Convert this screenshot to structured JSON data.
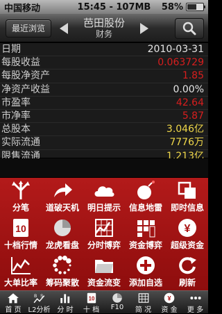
{
  "status_bar": {
    "carrier": "中国移动",
    "time_memory": "15:45 - 107MB",
    "battery": "58%",
    "battery_level": 0.58
  },
  "header": {
    "recent_label": "最近浏览",
    "stock_name": "芭田股份",
    "subtitle": "财务"
  },
  "rows": [
    {
      "label": "日期",
      "value": "2010-03-31",
      "color": "#e6e6e6"
    },
    {
      "label": "每股收益",
      "value": "0.063729",
      "color": "#d81e1e"
    },
    {
      "label": "每股净资产",
      "value": "1.85",
      "color": "#d81e1e"
    },
    {
      "label": "净资产收益",
      "value": "0.00%",
      "color": "#e6e6e6"
    },
    {
      "label": "市盈率",
      "value": "42.64",
      "color": "#d81e1e"
    },
    {
      "label": "市净率",
      "value": "5.87",
      "color": "#d81e1e"
    },
    {
      "label": "总股本",
      "value": "3.046亿",
      "color": "#f0d84a"
    },
    {
      "label": "实际流通",
      "value": "7776万",
      "color": "#f0d84a"
    },
    {
      "label": "限售流通",
      "value": "1.213亿",
      "color": "#f0d84a"
    }
  ],
  "grid": [
    {
      "label": "分笔",
      "icon": "split-arrows-icon"
    },
    {
      "label": "道破天机",
      "icon": "share-arrow-icon"
    },
    {
      "label": "明日提示",
      "icon": "cloud-icon"
    },
    {
      "label": "信息地雷",
      "icon": "bomb-icon"
    },
    {
      "label": "即时信息",
      "icon": "copy-icon"
    },
    {
      "label": "十档行情",
      "icon": "ten-icon",
      "glyph": "10"
    },
    {
      "label": "龙虎看盘",
      "icon": "pie-icon"
    },
    {
      "label": "分时博弈",
      "icon": "grid-chart-icon"
    },
    {
      "label": "资金博弈",
      "icon": "stacked-bars-icon"
    },
    {
      "label": "超级资金",
      "icon": "yen-icon",
      "glyph": "¥"
    },
    {
      "label": "大单比率",
      "icon": "line-chart-icon"
    },
    {
      "label": "筹码聚散",
      "icon": "dots-ring-icon"
    },
    {
      "label": "资金流变",
      "icon": "folder-icon"
    },
    {
      "label": "添加自选",
      "icon": "plus-icon"
    },
    {
      "label": "刷新",
      "icon": "refresh-icon"
    }
  ],
  "tabs": [
    {
      "label": "首 页",
      "icon": "home-icon"
    },
    {
      "label": "L2分析",
      "icon": "bs-chart-icon"
    },
    {
      "label": "分 时",
      "icon": "bars-icon"
    },
    {
      "label": "十 档",
      "icon": "ten-icon",
      "glyph": "10"
    },
    {
      "label": "F10",
      "icon": "pie-icon"
    },
    {
      "label": "简 况",
      "icon": "grid-icon"
    },
    {
      "label": "资 金",
      "icon": "yen-icon",
      "glyph": "¥"
    },
    {
      "label": "更 多",
      "icon": "more-icon"
    }
  ]
}
